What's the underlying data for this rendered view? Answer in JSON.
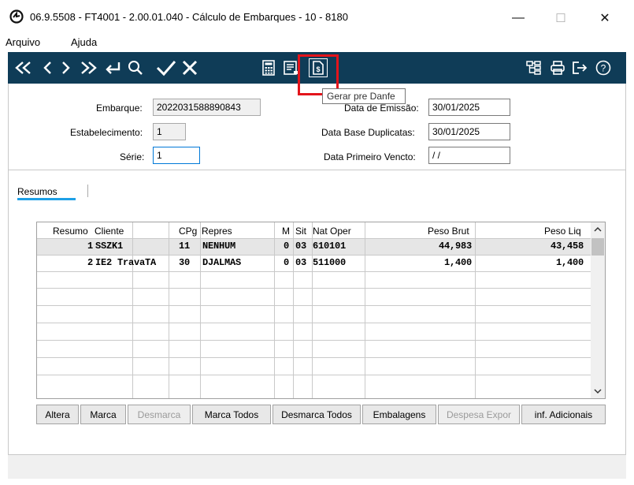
{
  "window": {
    "title": "06.9.5508 - FT4001 - 2.00.01.040 - Cálculo de Embarques - 10 - 8180",
    "minimize": "—",
    "maximize": "☐",
    "close": "✕"
  },
  "menu": {
    "items": [
      "Arquivo",
      "Ajuda"
    ]
  },
  "toolbar": {
    "accent": "#0f3c57",
    "icons": [
      "first-icon",
      "prev-icon",
      "next-icon",
      "last-icon",
      "return-icon",
      "search-icon",
      "confirm-icon",
      "cancel-icon",
      "calculator-icon",
      "document-list-icon",
      "gerar-pre-danfe-icon",
      "tree-icon",
      "print-icon",
      "exit-icon",
      "help-icon"
    ]
  },
  "tooltip": {
    "text": "Gerar pre Danfe"
  },
  "highlight_color": "#e3141b",
  "form": {
    "embarque_label": "Embarque:",
    "embarque_value": "2022031588890843",
    "estabelecimento_label": "Estabelecimento:",
    "estabelecimento_value": "1",
    "serie_label": "Série:",
    "serie_value": "1",
    "data_emissao_label": "Data de Emissão:",
    "data_emissao_value": "30/01/2025",
    "data_base_label": "Data Base Duplicatas:",
    "data_base_value": "30/01/2025",
    "data_vencto_label": "Data Primeiro Vencto:",
    "data_vencto_value": " / /"
  },
  "tabs": {
    "resumos": "Resumos"
  },
  "grid": {
    "headers": {
      "resumo": "Resumo",
      "cliente": "Cliente",
      "cpg": "CPg",
      "repres": "Repres",
      "m": "M",
      "sit": "Sit",
      "nat_oper": "Nat Oper",
      "peso_brut": "Peso Brut",
      "peso_liq": "Peso Liq"
    },
    "rows": [
      {
        "resumo": "1",
        "cliente": "SSZK1",
        "cpg": "11",
        "repres": "NENHUM",
        "m": "0",
        "sit": "03",
        "nat_oper": "610101",
        "peso_brut": "44,983",
        "peso_liq": "43,458"
      },
      {
        "resumo": "2",
        "cliente": "IE2 TravaTA",
        "cpg": "30",
        "repres": "DJALMAS",
        "m": "0",
        "sit": "03",
        "nat_oper": "511000",
        "peso_brut": "1,400",
        "peso_liq": "1,400"
      }
    ]
  },
  "buttons": {
    "altera": "Altera",
    "marca": "Marca",
    "desmarca": "Desmarca",
    "marca_todos": "Marca Todos",
    "desmarca_todos": "Desmarca Todos",
    "embalagens": "Embalagens",
    "despesa_expor": "Despesa Expor",
    "inf_adicionais": "inf. Adicionais"
  }
}
